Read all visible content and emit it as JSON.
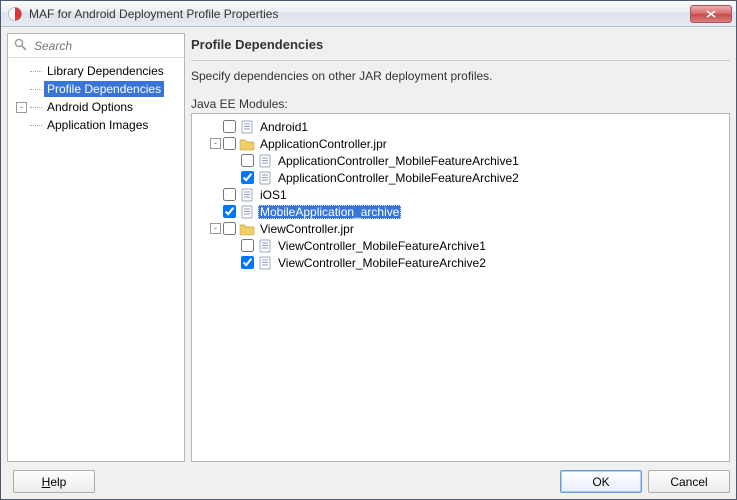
{
  "titlebar": {
    "title": "MAF for Android Deployment Profile Properties"
  },
  "search": {
    "placeholder": "Search"
  },
  "nav": {
    "items": [
      {
        "label": "Library Dependencies",
        "depth": 1,
        "expander": null,
        "selected": false
      },
      {
        "label": "Profile Dependencies",
        "depth": 1,
        "expander": null,
        "selected": true
      },
      {
        "label": "Android Options",
        "depth": 1,
        "expander": "-",
        "selected": false
      },
      {
        "label": "Application Images",
        "depth": 2,
        "expander": null,
        "selected": false
      }
    ]
  },
  "panel": {
    "header": "Profile Dependencies",
    "description": "Specify dependencies on other JAR deployment profiles.",
    "tree_label": "Java EE Modules:"
  },
  "tree": [
    {
      "depth": 0,
      "expander": null,
      "checked": false,
      "icon": "doc",
      "label": "Android1",
      "selected": false
    },
    {
      "depth": 0,
      "expander": "-",
      "checked": false,
      "icon": "folder",
      "label": "ApplicationController.jpr",
      "selected": false
    },
    {
      "depth": 1,
      "expander": null,
      "checked": false,
      "icon": "doc",
      "label": "ApplicationController_MobileFeatureArchive1",
      "selected": false
    },
    {
      "depth": 1,
      "expander": null,
      "checked": true,
      "icon": "doc",
      "label": "ApplicationController_MobileFeatureArchive2",
      "selected": false
    },
    {
      "depth": 0,
      "expander": null,
      "checked": false,
      "icon": "doc",
      "label": "iOS1",
      "selected": false
    },
    {
      "depth": 0,
      "expander": null,
      "checked": true,
      "icon": "doc",
      "label": "MobileApplication_archive",
      "selected": true
    },
    {
      "depth": 0,
      "expander": "-",
      "checked": false,
      "icon": "folder",
      "label": "ViewController.jpr",
      "selected": false
    },
    {
      "depth": 1,
      "expander": null,
      "checked": false,
      "icon": "doc",
      "label": "ViewController_MobileFeatureArchive1",
      "selected": false
    },
    {
      "depth": 1,
      "expander": null,
      "checked": true,
      "icon": "doc",
      "label": "ViewController_MobileFeatureArchive2",
      "selected": false
    }
  ],
  "buttons": {
    "help": "Help",
    "ok": "OK",
    "cancel": "Cancel"
  }
}
